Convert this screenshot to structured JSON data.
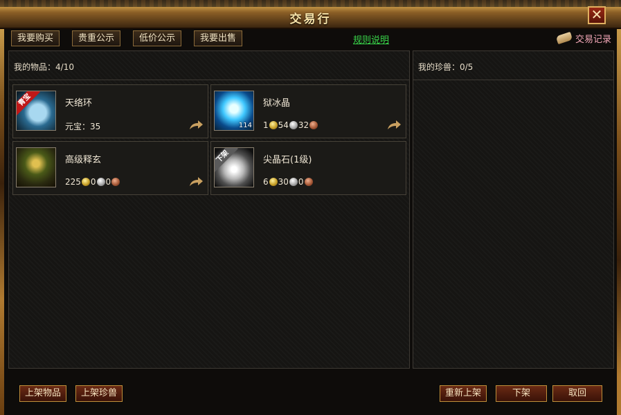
{
  "window": {
    "title": "交易行",
    "close_label": "✕"
  },
  "tabs": [
    "我要购买",
    "贵重公示",
    "低价公示",
    "我要出售"
  ],
  "rules_link": "规则说明",
  "records_label": "交易记录",
  "left_panel": {
    "header": "我的物品：4/10"
  },
  "right_panel": {
    "header": "我的珍兽：0/5"
  },
  "items": [
    {
      "name": "天络环",
      "price_text": "元宝：35",
      "badge": "青宝",
      "icon": "ring-icon"
    },
    {
      "name": "狱冰晶",
      "gold": "1",
      "silver": "54",
      "copper": "32",
      "quantity": "114",
      "icon": "ice-crystal-icon"
    },
    {
      "name": "高级释玄",
      "gold": "225",
      "silver": "0",
      "copper": "0",
      "icon": "monster-icon"
    },
    {
      "name": "尖晶石(1级)",
      "gold": "6",
      "silver": "30",
      "copper": "0",
      "badge": "下架",
      "icon": "gem-icon"
    }
  ],
  "buttons": {
    "list_item": "上架物品",
    "list_pet": "上架珍兽",
    "relist": "重新上架",
    "delist": "下架",
    "cancel": "取回"
  },
  "colors": {
    "rules_link": "#39d64a",
    "records": "#f4a8b8",
    "title": "#f6e2a8"
  }
}
